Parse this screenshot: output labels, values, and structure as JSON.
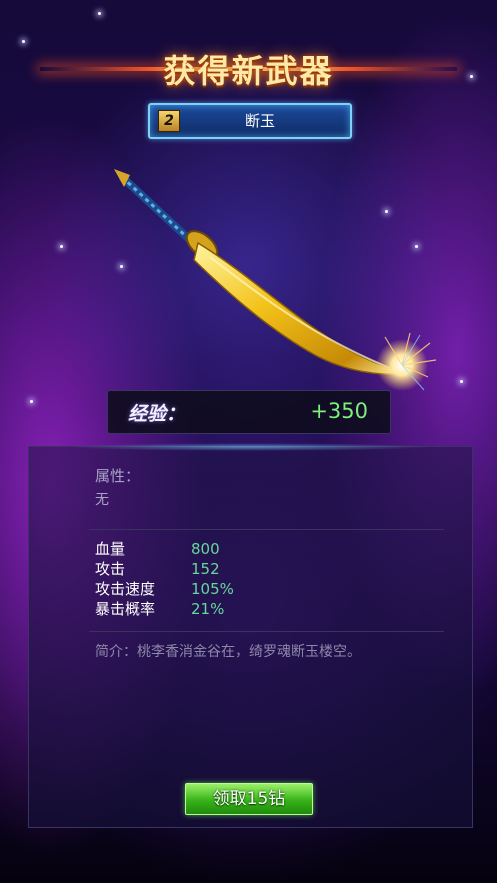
{
  "title": "获得新武器",
  "weapon": {
    "grade": "2",
    "name": "断玉"
  },
  "exp": {
    "label": "经验：",
    "value": "+350"
  },
  "attributes": {
    "label": "属性：",
    "value": "无"
  },
  "stats": [
    {
      "name": "血量",
      "value": "800"
    },
    {
      "name": "攻击",
      "value": "152"
    },
    {
      "name": "攻击速度",
      "value": "105%"
    },
    {
      "name": "暴击概率",
      "value": "21%"
    }
  ],
  "description": "简介：桃李香消金谷在，绮罗魂断玉楼空。",
  "claim_button": "领取15钻",
  "colors": {
    "title": "#ffe9a8",
    "stat_value": "#67d89b",
    "exp_value": "#7cf07a",
    "button": "#38b318"
  },
  "icons": [
    "sword-weapon-image",
    "grade-badge"
  ]
}
